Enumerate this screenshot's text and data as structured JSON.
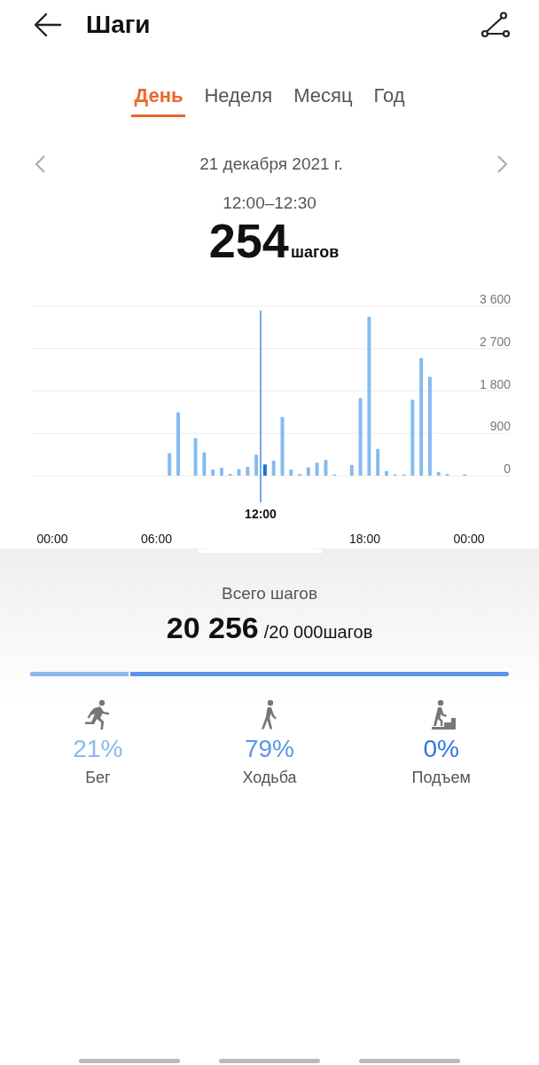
{
  "header": {
    "title": "Шаги"
  },
  "tabs": [
    {
      "label": "День",
      "selected": true
    },
    {
      "label": "Неделя",
      "selected": false
    },
    {
      "label": "Месяц",
      "selected": false
    },
    {
      "label": "Год",
      "selected": false
    }
  ],
  "date": "21 декабря 2021 г.",
  "selection": {
    "range": "12:00–12:30",
    "steps": "254",
    "unit": "шагов"
  },
  "chart_data": {
    "type": "bar",
    "x": [
      6.75,
      7.25,
      8.25,
      8.75,
      9.25,
      9.75,
      10.25,
      10.75,
      11.25,
      11.75,
      12.25,
      12.75,
      13.25,
      13.75,
      14.25,
      14.75,
      15.25,
      15.75,
      16.25,
      17.25,
      17.75,
      18.25,
      18.75,
      19.25,
      19.75,
      20.25,
      20.75,
      21.25,
      21.75,
      22.25,
      22.75,
      23.75
    ],
    "grid": true,
    "xlim": [
      0,
      24
    ],
    "values": [
      480,
      1350,
      800,
      500,
      130,
      170,
      40,
      140,
      190,
      450,
      240,
      320,
      1250,
      130,
      40,
      180,
      280,
      340,
      30,
      230,
      1650,
      3380,
      570,
      100,
      30,
      30,
      1610,
      2500,
      2100,
      80,
      40,
      30
    ],
    "ylim": [
      0,
      3600
    ],
    "yticks": [
      {
        "value": 0,
        "label": "0"
      },
      {
        "value": 900,
        "label": "900"
      },
      {
        "value": 1800,
        "label": "1 800"
      },
      {
        "value": 2700,
        "label": "2 700"
      },
      {
        "value": 3600,
        "label": "3 600"
      }
    ],
    "xticks": [
      {
        "value": 0,
        "label": "00:00"
      },
      {
        "value": 6,
        "label": "06:00"
      },
      {
        "value": 18,
        "label": "18:00"
      },
      {
        "value": 24,
        "label": "00:00"
      }
    ],
    "ref_lines": [
      {
        "axis": "x",
        "value": 12,
        "label": "12:00"
      }
    ]
  },
  "summary": {
    "title": "Всего шагов",
    "total": "20 256",
    "goal": "/20 000шагов"
  },
  "activity_bar": {
    "level": 0.21
  },
  "activities": [
    {
      "kind": "run",
      "percent": "21%",
      "label": "Бег",
      "color": "#8ab8f0"
    },
    {
      "kind": "walk",
      "percent": "79%",
      "label": "Ходьба",
      "color": "#5b95ea"
    },
    {
      "kind": "climb",
      "percent": "0%",
      "label": "Подъем",
      "color": "#2f74e0"
    }
  ]
}
